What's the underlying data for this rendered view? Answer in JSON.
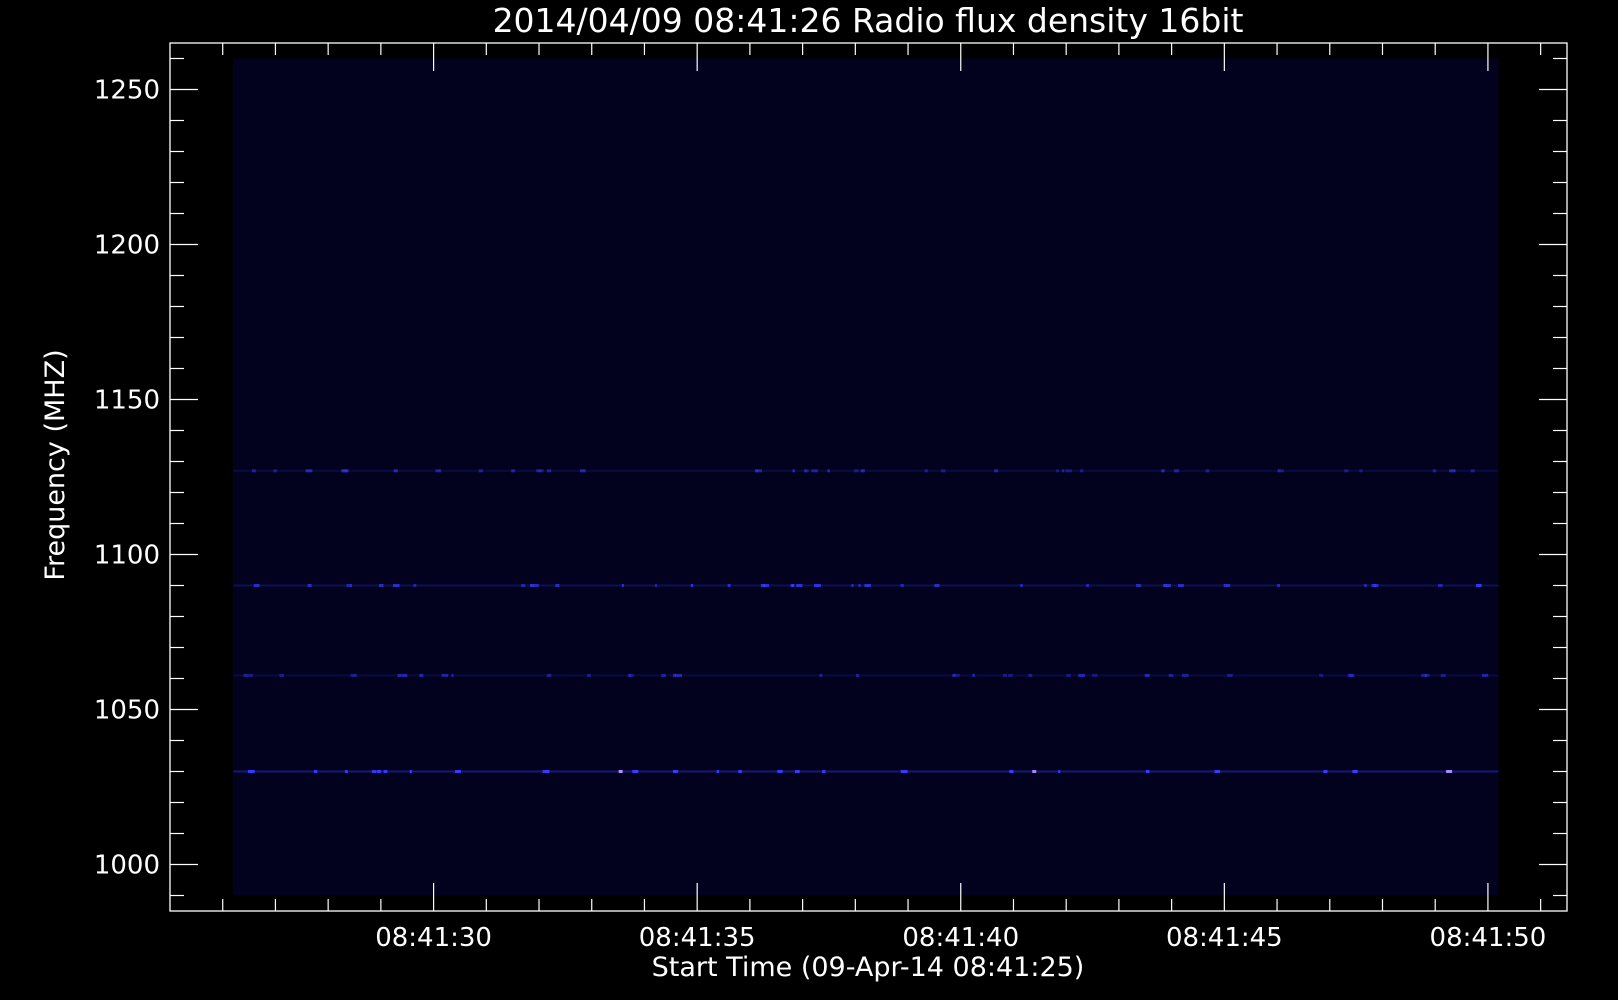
{
  "chart_data": {
    "type": "heatmap",
    "title": "2014/04/09 08:41:26 Radio flux density 16bit",
    "xlabel": "Start Time (09-Apr-14 08:41:25)",
    "ylabel": "Frequency (MHZ)",
    "x_range": [
      "08:41:25",
      "08:41:51.5"
    ],
    "y_range": [
      985,
      1265
    ],
    "data_x_range": [
      "08:41:26.2",
      "08:41:50.2"
    ],
    "data_y_range": [
      990,
      1260
    ],
    "x_ticks": [
      "08:41:30",
      "08:41:35",
      "08:41:40",
      "08:41:45",
      "08:41:50"
    ],
    "y_ticks": [
      1000,
      1050,
      1100,
      1150,
      1200,
      1250
    ],
    "background_color": "#02021f",
    "emission_color": "#3a3aff",
    "bands": [
      {
        "freq": 1127,
        "intensity": "faint"
      },
      {
        "freq": 1090,
        "intensity": "medium"
      },
      {
        "freq": 1061,
        "intensity": "faint"
      },
      {
        "freq": 1030,
        "intensity": "bright"
      }
    ]
  }
}
